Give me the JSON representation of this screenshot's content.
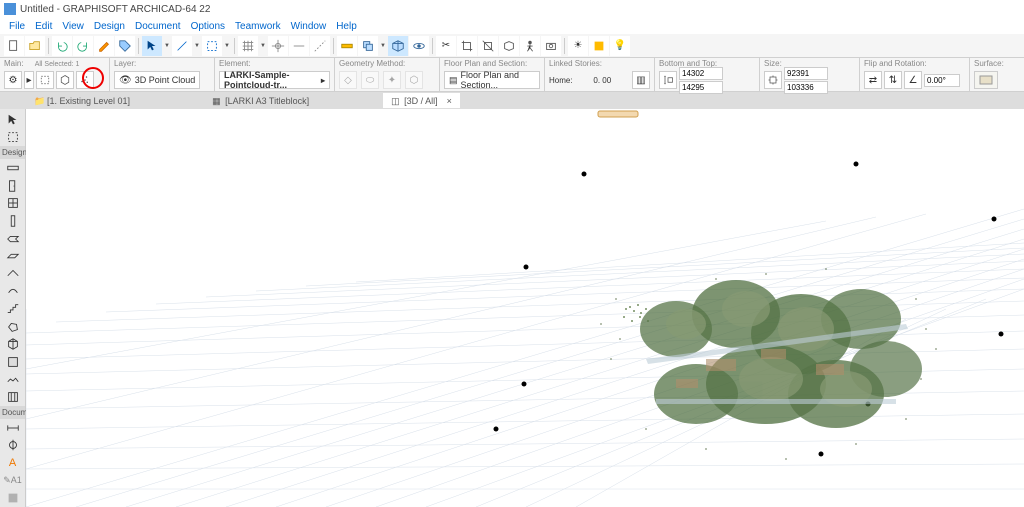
{
  "titlebar": {
    "text": "Untitled - GRAPHISOFT ARCHICAD-64 22"
  },
  "menu": {
    "items": [
      "File",
      "Edit",
      "View",
      "Design",
      "Document",
      "Options",
      "Teamwork",
      "Window",
      "Help"
    ]
  },
  "toolbar1_icons": [
    "new",
    "open",
    "save",
    "undo",
    "redo",
    "sep",
    "cut",
    "copy",
    "paste",
    "sep",
    "arrow",
    "line",
    "arc",
    "sep",
    "grid",
    "snap",
    "sep",
    "measure",
    "sep",
    "ortho",
    "trace",
    "sep",
    "a",
    "b",
    "c",
    "d",
    "e",
    "f",
    "g",
    "h",
    "i"
  ],
  "info": {
    "main": {
      "label": "Main:",
      "selected": "All Selected: 1"
    },
    "layer": {
      "label": "Layer:",
      "value": "3D Point Cloud"
    },
    "element": {
      "label": "Element:",
      "value": "LARKI-Sample-Pointcloud-tr..."
    },
    "geometry": {
      "label": "Geometry Method:"
    },
    "floorplan": {
      "label": "Floor Plan and Section:",
      "value": "Floor Plan and Section..."
    },
    "linkedstories": {
      "label": "Linked Stories:",
      "home": "Home:",
      "val": "0. 00"
    },
    "bottomtop": {
      "label": "Bottom and Top:",
      "v1": "14302",
      "v2": "14295"
    },
    "size": {
      "label": "Size:",
      "v1": "92391",
      "v2": "103336"
    },
    "fliprotation": {
      "label": "Flip and Rotation:",
      "angle": "0.00°"
    },
    "surface": {
      "label": "Surface:"
    }
  },
  "tabs": [
    {
      "name": "[1. Existing Level 01]",
      "icon": "folder",
      "active": false
    },
    {
      "name": "[LARKI A3 Titleblock]",
      "icon": "layout",
      "active": false
    },
    {
      "name": "[3D / All]",
      "icon": "cube",
      "active": true
    }
  ],
  "left_tools": {
    "arrow": "arrow",
    "design_label": "Design",
    "design": [
      "wall",
      "door",
      "window",
      "column",
      "beam",
      "slab",
      "roof",
      "shell",
      "stair",
      "morph",
      "object",
      "zone",
      "mesh",
      "curtain"
    ],
    "document_label": "Documen",
    "document": [
      "dim",
      "text",
      "label",
      "fill"
    ]
  }
}
